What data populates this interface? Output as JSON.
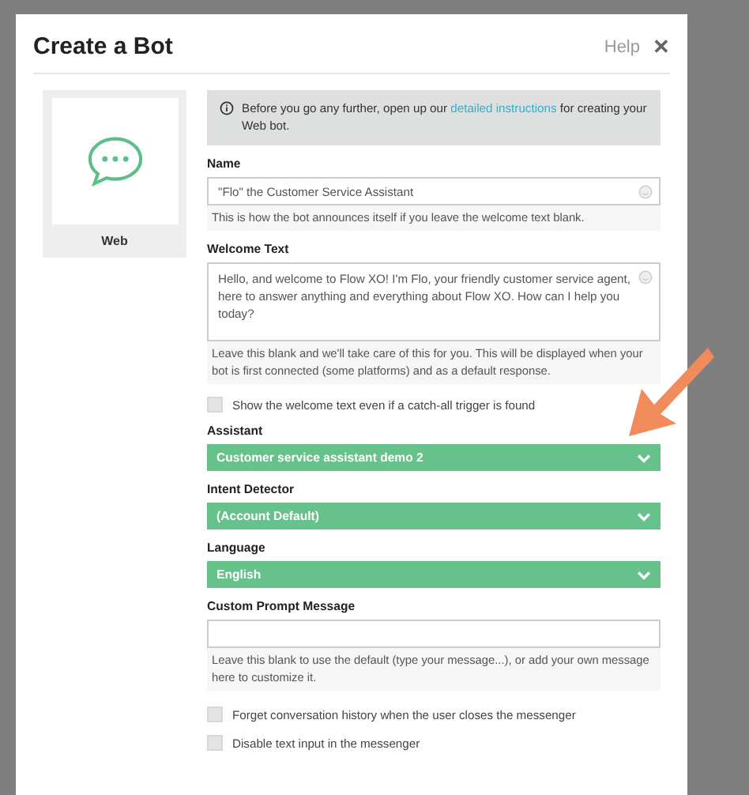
{
  "dialog": {
    "title": "Create a Bot",
    "help": "Help",
    "close": "✕"
  },
  "platform": {
    "label": "Web"
  },
  "notice": {
    "text": "Before you go any further, open up our ",
    "link": "detailed instructions",
    "after": " for creating your Web bot."
  },
  "fields": [
    {
      "kind": "text",
      "label": "Name",
      "value": "\"Flo\" the Customer Service Assistant",
      "hint": "This is how the bot announces itself if you leave the welcome text blank."
    },
    {
      "kind": "textarea",
      "label": "Welcome Text",
      "value": "Hello, and welcome to Flow XO! I'm Flo, your friendly customer service agent, here to answer anything and everything about Flow XO. How can I help you today?",
      "hint": "Leave this blank and we'll take care of this for you. This will be displayed when your bot is first connected (some platforms) and as a default response."
    },
    {
      "kind": "checkbox",
      "label": "Show the welcome text even if a catch-all trigger is found",
      "checked": false
    },
    {
      "kind": "select",
      "label": "Assistant",
      "value": "Customer service assistant demo 2"
    },
    {
      "kind": "select",
      "label": "Intent Detector",
      "value": "(Account Default)"
    },
    {
      "kind": "select",
      "label": "Language",
      "value": "English"
    },
    {
      "kind": "text",
      "label": "Custom Prompt Message",
      "hint": "Leave this blank to use the default (type your message...), or add your own message here to customize it."
    },
    {
      "kind": "checkbox",
      "label": "Forget conversation history when the user closes the messenger",
      "checked": false
    },
    {
      "kind": "checkbox",
      "label": "Disable text input in the messenger",
      "checked": false
    }
  ]
}
